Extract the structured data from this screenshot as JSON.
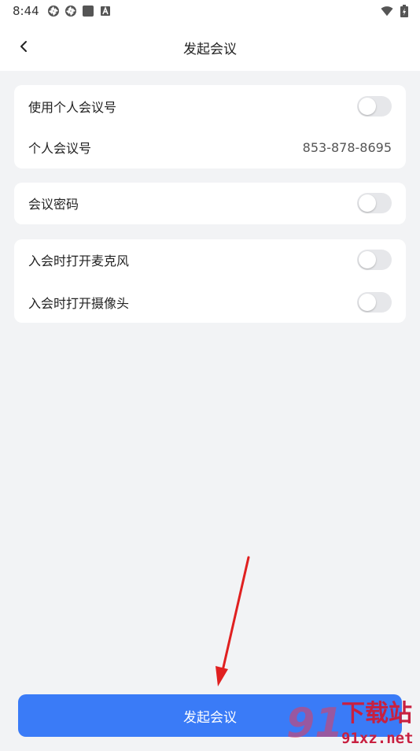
{
  "status_bar": {
    "time": "8:44",
    "left_icons": [
      "aperture-icon",
      "aperture-icon",
      "square-app-icon",
      "a-letter-icon"
    ],
    "right_icons": [
      "wifi-icon",
      "battery-charging-icon"
    ]
  },
  "nav": {
    "back_icon": "chevron-left-icon",
    "title": "发起会议"
  },
  "settings": {
    "use_personal_id": {
      "label": "使用个人会议号",
      "enabled": false
    },
    "personal_id": {
      "label": "个人会议号",
      "value": "853-878-8695"
    },
    "meeting_password": {
      "label": "会议密码",
      "enabled": false
    },
    "mic_on_join": {
      "label": "入会时打开麦克风",
      "enabled": false
    },
    "camera_on_join": {
      "label": "入会时打开摄像头",
      "enabled": false
    }
  },
  "start_button": {
    "label": "发起会议"
  },
  "annotation": {
    "arrow_color": "#e02020"
  },
  "watermark": {
    "text_main": "下载站",
    "text_sub": "91xz.net",
    "logo_text": "91"
  },
  "colors": {
    "accent": "#3a7bf7",
    "background": "#f2f3f5",
    "toggle_off": "#e6e7ea"
  }
}
